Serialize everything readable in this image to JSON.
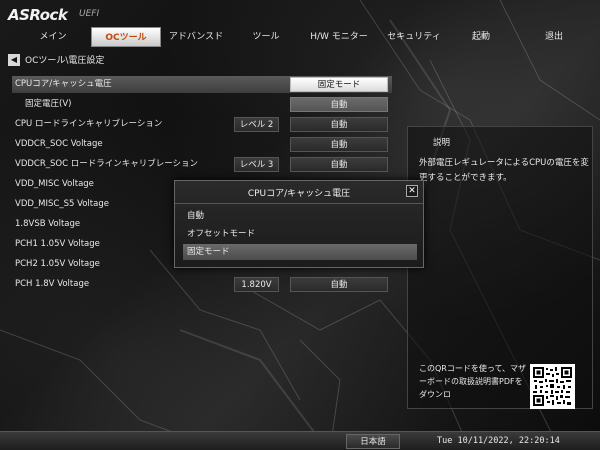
{
  "header": {
    "logo": "ASRock",
    "logo_sub": "UEFI",
    "tabs": [
      {
        "label": "メイン"
      },
      {
        "label": "OCツール"
      },
      {
        "label": "アドバンスド"
      },
      {
        "label": "ツール"
      },
      {
        "label": "H/W モニター"
      },
      {
        "label": "セキュリティ"
      },
      {
        "label": "起動"
      },
      {
        "label": "退出"
      }
    ],
    "active_tab": "OCツール"
  },
  "breadcrumb": "OCツール\\電圧設定",
  "settings": [
    {
      "label": "CPUコア/キャッシュ電圧",
      "option": "固定モード"
    },
    {
      "label": "固定電圧(V)",
      "option": "自動"
    },
    {
      "label": "CPU ロードラインキャリブレーション",
      "level": "レベル 2",
      "option": "自動"
    },
    {
      "label": "VDDCR_SOC Voltage",
      "option": "自動"
    },
    {
      "label": "VDDCR_SOC ロードラインキャリブレーション",
      "level": "レベル 3",
      "option": "自動"
    },
    {
      "label": "VDD_MISC Voltage"
    },
    {
      "label": "VDD_MISC_S5 Voltage"
    },
    {
      "label": "1.8VSB Voltage"
    },
    {
      "label": "PCH1 1.05V Voltage"
    },
    {
      "label": "PCH2 1.05V Voltage"
    },
    {
      "label": "PCH 1.8V Voltage",
      "level": "1.820V",
      "option": "自動"
    }
  ],
  "description": {
    "title": "説明",
    "body": "外部電圧レギュレータによるCPUの電圧を変更することができます。",
    "qr_text": "このQRコードを使って、マザーボードの取扱説明書PDFをダウンロ"
  },
  "dialog": {
    "title": "CPUコア/キャッシュ電圧",
    "close": "✕",
    "options": [
      {
        "label": "自動"
      },
      {
        "label": "オフセットモード"
      },
      {
        "label": "固定モード"
      }
    ],
    "selected": "固定モード"
  },
  "footer": {
    "language": "日本語",
    "datetime": "Tue 10/11/2022, 22:20:14"
  },
  "icons": {
    "back": "◀",
    "close": "close-icon",
    "qr": "qr-code"
  },
  "colors": {
    "accent": "#c04a10",
    "highlight": "#ffffff",
    "background": "#111111"
  }
}
